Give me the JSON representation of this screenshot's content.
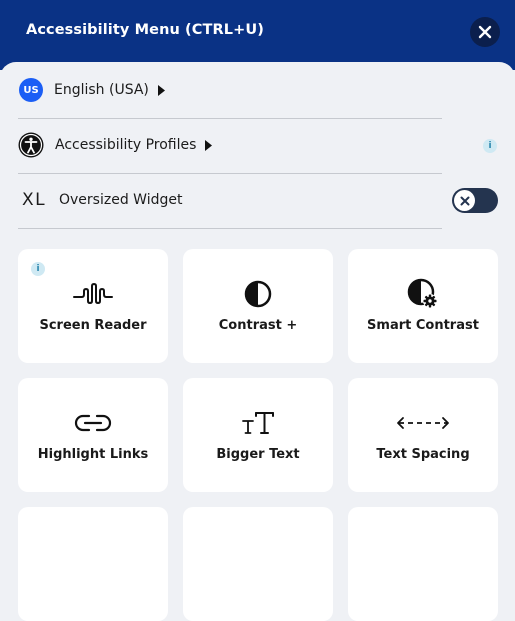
{
  "header": {
    "title": "Accessibility Menu (CTRL+U)"
  },
  "language": {
    "badge": "US",
    "label": "English (USA)"
  },
  "profiles": {
    "label": "Accessibility Profiles",
    "info": "i"
  },
  "oversized": {
    "icon_text": "XL",
    "label": "Oversized Widget",
    "enabled": false
  },
  "tiles": [
    {
      "label": "Screen Reader",
      "icon": "waveform-icon",
      "info": "i"
    },
    {
      "label": "Contrast +",
      "icon": "half-circle-icon"
    },
    {
      "label": "Smart Contrast",
      "icon": "half-circle-gear-icon"
    },
    {
      "label": "Highlight Links",
      "icon": "link-icon"
    },
    {
      "label": "Bigger Text",
      "icon": "text-size-icon"
    },
    {
      "label": "Text Spacing",
      "icon": "spacing-arrows-icon"
    }
  ],
  "colors": {
    "header_bg": "#0a3285",
    "panel_bg": "#eff1f5",
    "badge_blue": "#1b5ef5",
    "toggle_bg": "#24344f"
  }
}
